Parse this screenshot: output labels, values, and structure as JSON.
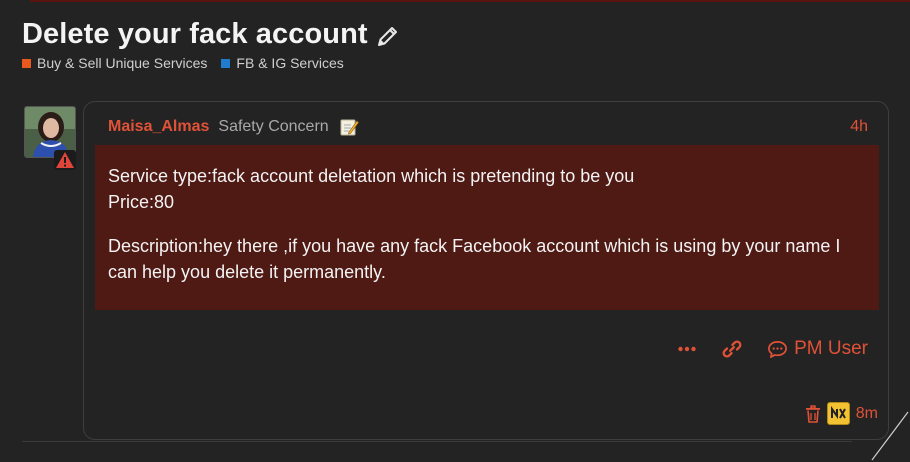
{
  "topic": {
    "title": "Delete your fack account",
    "categories": [
      {
        "label": "Buy & Sell Unique Services",
        "color": "#e8581f"
      },
      {
        "label": "FB & IG Services",
        "color": "#1f7ccf"
      }
    ]
  },
  "post": {
    "username": "Maisa_Almas",
    "user_title": "Safety Concern",
    "time": "4h",
    "body": {
      "line1": "Service type:fack account deletation which is pretending to be you",
      "line2": "Price:80",
      "line3": "Description:hey there ,if you have any fack Facebook account which is using by your name I can help you delete it permanently."
    },
    "actions": {
      "pm_label": "PM User"
    },
    "footer": {
      "edit_time": "8m"
    }
  },
  "colors": {
    "accent": "#e05237",
    "body_bg": "#4f1914",
    "page_bg": "#232323"
  },
  "icons": [
    "pencil-icon",
    "memo-icon",
    "warning-icon",
    "more-icon",
    "link-icon",
    "chat-icon",
    "trash-icon",
    "admin-badge-icon"
  ]
}
